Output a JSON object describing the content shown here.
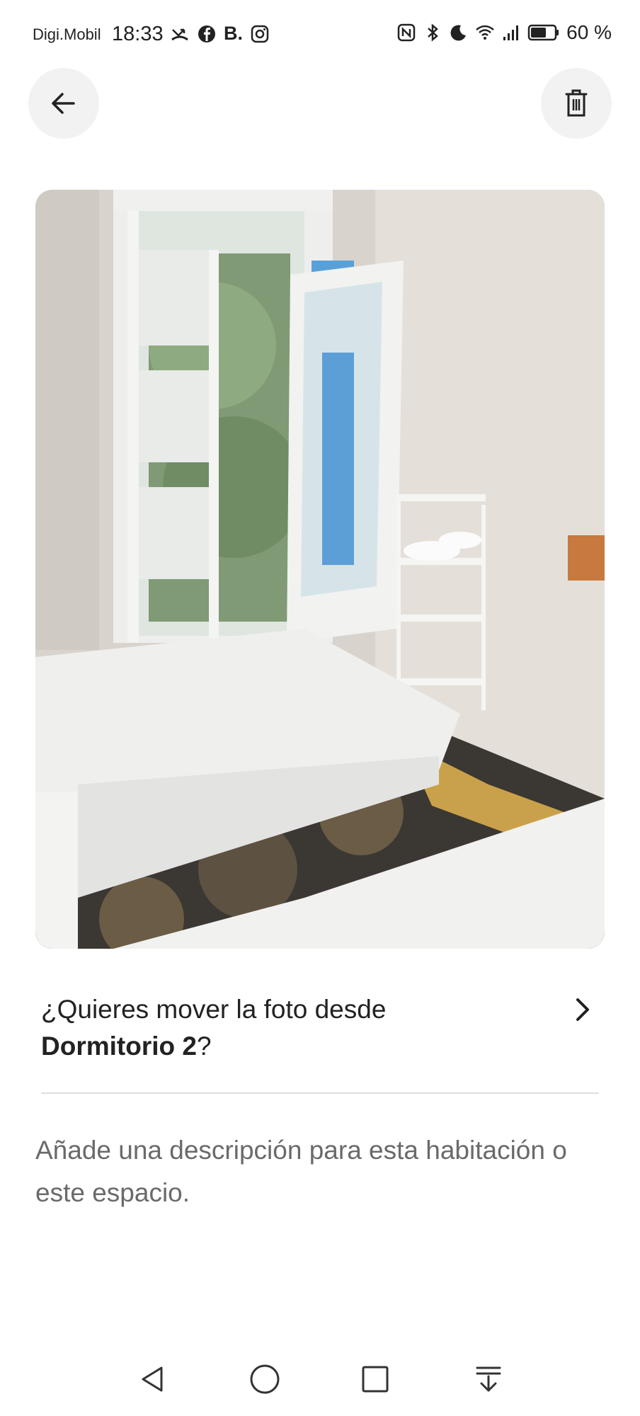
{
  "status_bar": {
    "carrier": "Digi.Mobil",
    "time": "18:33",
    "battery_percent": "60 %",
    "left_icons": [
      "missed-call-icon",
      "facebook-icon",
      "booking-icon",
      "instagram-icon"
    ],
    "right_icons": [
      "nfc-icon",
      "bluetooth-icon",
      "do-not-disturb-icon",
      "wifi-icon",
      "signal-icon",
      "battery-icon"
    ],
    "booking_letter": "B."
  },
  "header": {
    "back_icon": "arrow-left-icon",
    "delete_icon": "trash-icon"
  },
  "photo": {
    "description": "Bedroom photo"
  },
  "move_prompt": {
    "prefix": "¿Quieres mover la foto desde ",
    "room": "Dormitorio 2",
    "suffix": "?"
  },
  "description_field": {
    "placeholder": "Añade una descripción para esta habitación o este espacio."
  },
  "nav_bar": {
    "icons": [
      "back-triangle-icon",
      "home-circle-icon",
      "recents-square-icon",
      "notification-pull-icon"
    ]
  }
}
